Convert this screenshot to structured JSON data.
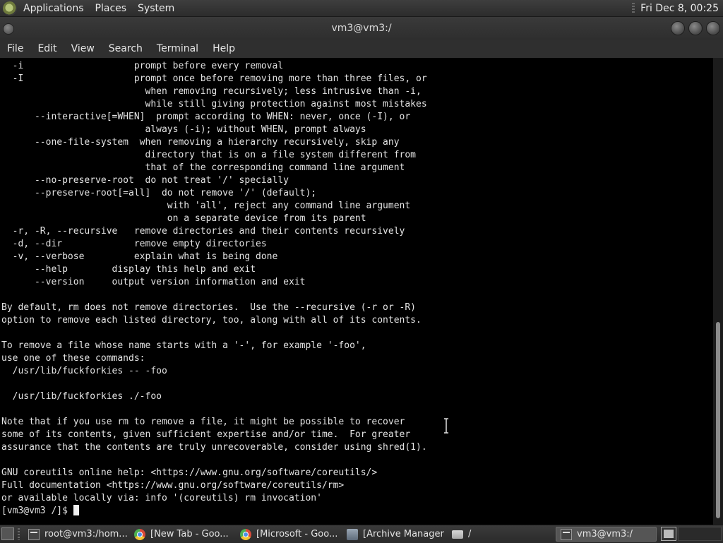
{
  "top_panel": {
    "menus": [
      "Applications",
      "Places",
      "System"
    ],
    "clock": "Fri Dec  8, 00:25"
  },
  "window": {
    "title": "vm3@vm3:/"
  },
  "menubar": [
    "File",
    "Edit",
    "View",
    "Search",
    "Terminal",
    "Help"
  ],
  "terminal": {
    "lines": [
      "  -i                    prompt before every removal",
      "  -I                    prompt once before removing more than three files, or",
      "                          when removing recursively; less intrusive than -i,",
      "                          while still giving protection against most mistakes",
      "      --interactive[=WHEN]  prompt according to WHEN: never, once (-I), or",
      "                          always (-i); without WHEN, prompt always",
      "      --one-file-system  when removing a hierarchy recursively, skip any",
      "                          directory that is on a file system different from",
      "                          that of the corresponding command line argument",
      "      --no-preserve-root  do not treat '/' specially",
      "      --preserve-root[=all]  do not remove '/' (default);",
      "                              with 'all', reject any command line argument",
      "                              on a separate device from its parent",
      "  -r, -R, --recursive   remove directories and their contents recursively",
      "  -d, --dir             remove empty directories",
      "  -v, --verbose         explain what is being done",
      "      --help        display this help and exit",
      "      --version     output version information and exit",
      "",
      "By default, rm does not remove directories.  Use the --recursive (-r or -R)",
      "option to remove each listed directory, too, along with all of its contents.",
      "",
      "To remove a file whose name starts with a '-', for example '-foo',",
      "use one of these commands:",
      "  /usr/lib/fuckforkies -- -foo",
      "",
      "  /usr/lib/fuckforkies ./-foo",
      "",
      "Note that if you use rm to remove a file, it might be possible to recover",
      "some of its contents, given sufficient expertise and/or time.  For greater",
      "assurance that the contents are truly unrecoverable, consider using shred(1).",
      "",
      "GNU coreutils online help: <https://www.gnu.org/software/coreutils/>",
      "Full documentation <https://www.gnu.org/software/coreutils/rm>",
      "or available locally via: info '(coreutils) rm invocation'"
    ],
    "prompt": "[vm3@vm3 /]$ "
  },
  "taskbar": {
    "tasks": [
      {
        "label": "root@vm3:/hom...",
        "icon": "terminal-icon",
        "active": false
      },
      {
        "label": "[New Tab - Goo...",
        "icon": "chrome-icon",
        "active": false
      },
      {
        "label": "[Microsoft - Goo...",
        "icon": "chrome-icon",
        "active": false
      },
      {
        "label": "[Archive Manager]",
        "icon": "archive-manager-icon",
        "active": false
      },
      {
        "label": "/",
        "icon": "folder-icon",
        "active": false
      },
      {
        "label": "vm3@vm3:/",
        "icon": "terminal-icon",
        "active": true
      }
    ]
  }
}
